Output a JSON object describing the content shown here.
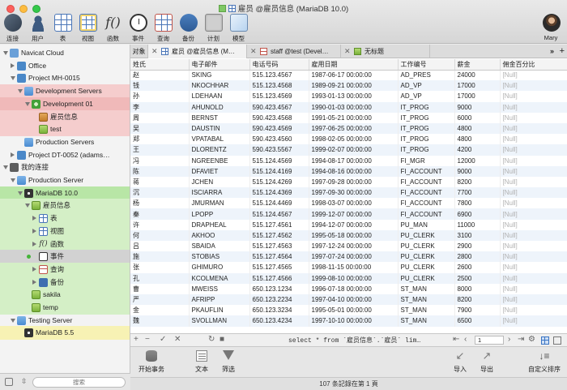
{
  "window": {
    "title": "雇员 @雇员信息 (MariaDB 10.0)"
  },
  "toolbar": {
    "items": [
      {
        "label": "连接",
        "icon": "connection-icon"
      },
      {
        "label": "用户",
        "icon": "user-icon"
      },
      {
        "label": "表",
        "icon": "table-icon"
      },
      {
        "label": "视图",
        "icon": "view-icon"
      },
      {
        "label": "函数",
        "icon": "function-icon"
      },
      {
        "label": "事件",
        "icon": "event-icon"
      },
      {
        "label": "查询",
        "icon": "query-icon"
      },
      {
        "label": "备份",
        "icon": "backup-icon"
      },
      {
        "label": "计划",
        "icon": "schedule-icon"
      },
      {
        "label": "模型",
        "icon": "model-icon"
      }
    ],
    "user": "Mary"
  },
  "sidebar": {
    "tree": [
      {
        "label": "Navicat Cloud",
        "indent": 0,
        "disc": "open",
        "icon": "cloud"
      },
      {
        "label": "Office",
        "indent": 1,
        "disc": "closed",
        "icon": "proj"
      },
      {
        "label": "Project MH-0015",
        "indent": 1,
        "disc": "open",
        "icon": "proj"
      },
      {
        "label": "Development Servers",
        "indent": 2,
        "disc": "open",
        "icon": "folder",
        "bg": "row-red"
      },
      {
        "label": "Development 01",
        "indent": 3,
        "disc": "open",
        "icon": "conn-red",
        "bg": "row-red2"
      },
      {
        "label": "雇员信息",
        "indent": 4,
        "disc": "",
        "icon": "db-red",
        "bg": "row-red"
      },
      {
        "label": "test",
        "indent": 4,
        "disc": "",
        "icon": "db",
        "bg": "row-red"
      },
      {
        "label": "Production Servers",
        "indent": 2,
        "disc": "",
        "icon": "folder"
      },
      {
        "label": "Project DT-0052 (adams…",
        "indent": 1,
        "disc": "closed",
        "icon": "proj"
      },
      {
        "label": "我的连接",
        "indent": 0,
        "disc": "open",
        "icon": "home"
      },
      {
        "label": "Production Server",
        "indent": 1,
        "disc": "open",
        "icon": "folder"
      },
      {
        "label": "MariaDB 10.0",
        "indent": 2,
        "disc": "open",
        "icon": "maria",
        "bg": "row-green2"
      },
      {
        "label": "雇员信息",
        "indent": 3,
        "disc": "open",
        "icon": "db",
        "bg": "row-green"
      },
      {
        "label": "表",
        "indent": 4,
        "disc": "closed",
        "icon": "table",
        "bg": "row-green"
      },
      {
        "label": "视图",
        "indent": 4,
        "disc": "closed",
        "icon": "table",
        "bg": "row-green"
      },
      {
        "label": "函数",
        "indent": 4,
        "disc": "closed",
        "icon": "func",
        "bg": "row-green"
      },
      {
        "label": "事件",
        "indent": 4,
        "disc": "",
        "icon": "event",
        "bg": "row-sel",
        "dot": true
      },
      {
        "label": "查询",
        "indent": 4,
        "disc": "closed",
        "icon": "query",
        "bg": "row-green"
      },
      {
        "label": "备份",
        "indent": 4,
        "disc": "closed",
        "icon": "backup",
        "bg": "row-green"
      },
      {
        "label": "sakila",
        "indent": 3,
        "disc": "",
        "icon": "db",
        "bg": "row-green"
      },
      {
        "label": "temp",
        "indent": 3,
        "disc": "",
        "icon": "db",
        "bg": "row-green"
      },
      {
        "label": "Testing Server",
        "indent": 1,
        "disc": "open",
        "icon": "folder"
      },
      {
        "label": "MariaDB 5.5",
        "indent": 2,
        "disc": "",
        "icon": "maria",
        "bg": "row-yellow"
      }
    ],
    "search_placeholder": "搜索"
  },
  "tabs": {
    "object_label": "对象",
    "items": [
      {
        "label": "雇员 @雇员信息 (M…",
        "icon": "table",
        "active": true
      },
      {
        "label": "staff @test (Devel…",
        "icon": "query",
        "active": false
      },
      {
        "label": "无标题",
        "icon": "doc",
        "active": false
      }
    ]
  },
  "grid": {
    "columns": [
      "姓氏",
      "电子邮件",
      "电话号码",
      "雇用日期",
      "工作编号",
      "薪金",
      "佣金百分比"
    ],
    "rows": [
      [
        "赵",
        "SKING",
        "515.123.4567",
        "1987-06-17 00:00:00",
        "AD_PRES",
        "24000",
        "[Null]"
      ],
      [
        "钱",
        "NKOCHHAR",
        "515.123.4568",
        "1989-09-21 00:00:00",
        "AD_VP",
        "17000",
        "[Null]"
      ],
      [
        "孙",
        "LDEHAAN",
        "515.123.4569",
        "1993-01-13 00:00:00",
        "AD_VP",
        "17000",
        "[Null]"
      ],
      [
        "李",
        "AHUNOLD",
        "590.423.4567",
        "1990-01-03 00:00:00",
        "IT_PROG",
        "9000",
        "[Null]"
      ],
      [
        "周",
        "BERNST",
        "590.423.4568",
        "1991-05-21 00:00:00",
        "IT_PROG",
        "6000",
        "[Null]"
      ],
      [
        "吴",
        "DAUSTIN",
        "590.423.4569",
        "1997-06-25 00:00:00",
        "IT_PROG",
        "4800",
        "[Null]"
      ],
      [
        "郑",
        "VPATABAL",
        "590.423.4560",
        "1998-02-05 00:00:00",
        "IT_PROG",
        "4800",
        "[Null]"
      ],
      [
        "王",
        "DLORENTZ",
        "590.423.5567",
        "1999-02-07 00:00:00",
        "IT_PROG",
        "4200",
        "[Null]"
      ],
      [
        "冯",
        "NGREENBE",
        "515.124.4569",
        "1994-08-17 00:00:00",
        "FI_MGR",
        "12000",
        "[Null]"
      ],
      [
        "陈",
        "DFAVIET",
        "515.124.4169",
        "1994-08-16 00:00:00",
        "FI_ACCOUNT",
        "9000",
        "[Null]"
      ],
      [
        "蒋",
        "JCHEN",
        "515.124.4269",
        "1997-09-28 00:00:00",
        "FI_ACCOUNT",
        "8200",
        "[Null]"
      ],
      [
        "沉",
        "ISCIARRA",
        "515.124.4369",
        "1997-09-30 00:00:00",
        "FI_ACCOUNT",
        "7700",
        "[Null]"
      ],
      [
        "杨",
        "JMURMAN",
        "515.124.4469",
        "1998-03-07 00:00:00",
        "FI_ACCOUNT",
        "7800",
        "[Null]"
      ],
      [
        "秦",
        "LPOPP",
        "515.124.4567",
        "1999-12-07 00:00:00",
        "FI_ACCOUNT",
        "6900",
        "[Null]"
      ],
      [
        "许",
        "DRAPHEAL",
        "515.127.4561",
        "1994-12-07 00:00:00",
        "PU_MAN",
        "11000",
        "[Null]"
      ],
      [
        "何",
        "AKHOO",
        "515.127.4562",
        "1995-05-18 00:00:00",
        "PU_CLERK",
        "3100",
        "[Null]"
      ],
      [
        "吕",
        "SBAIDA",
        "515.127.4563",
        "1997-12-24 00:00:00",
        "PU_CLERK",
        "2900",
        "[Null]"
      ],
      [
        "施",
        "STOBIAS",
        "515.127.4564",
        "1997-07-24 00:00:00",
        "PU_CLERK",
        "2800",
        "[Null]"
      ],
      [
        "张",
        "GHIMURO",
        "515.127.4565",
        "1998-11-15 00:00:00",
        "PU_CLERK",
        "2600",
        "[Null]"
      ],
      [
        "孔",
        "KCOLMENA",
        "515.127.4566",
        "1999-08-10 00:00:00",
        "PU_CLERK",
        "2500",
        "[Null]"
      ],
      [
        "曹",
        "MWEISS",
        "650.123.1234",
        "1996-07-18 00:00:00",
        "ST_MAN",
        "8000",
        "[Null]"
      ],
      [
        "严",
        "AFRIPP",
        "650.123.2234",
        "1997-04-10 00:00:00",
        "ST_MAN",
        "8200",
        "[Null]"
      ],
      [
        "金",
        "PKAUFLIN",
        "650.123.3234",
        "1995-05-01 00:00:00",
        "ST_MAN",
        "7900",
        "[Null]"
      ],
      [
        "魏",
        "SVOLLMAN",
        "650.123.4234",
        "1997-10-10 00:00:00",
        "ST_MAN",
        "6500",
        "[Null]"
      ]
    ]
  },
  "gridbar": {
    "sql": "select * from `雇员信息`.`雇员` lim…",
    "page": "1"
  },
  "actions": {
    "begin_transaction": "开始事务",
    "text": "文本",
    "filter": "筛选",
    "import": "导入",
    "export": "导出",
    "custom_sort": "自定义排序"
  },
  "status": "107 条記錄在第 1 頁",
  "colors": {
    "accent": "#3a74c4",
    "row_alt": "#eef4fb",
    "null_text": "#b0b0b0"
  }
}
